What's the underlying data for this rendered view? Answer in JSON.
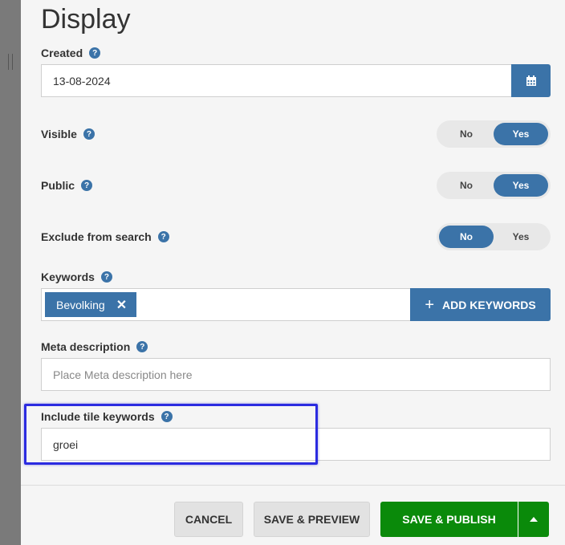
{
  "panel": {
    "title": "Display"
  },
  "created": {
    "label": "Created",
    "help": "?",
    "value": "13-08-2024"
  },
  "visible": {
    "label": "Visible",
    "help": "?",
    "no": "No",
    "yes": "Yes",
    "selected": "Yes"
  },
  "public": {
    "label": "Public",
    "help": "?",
    "no": "No",
    "yes": "Yes",
    "selected": "Yes"
  },
  "exclude_search": {
    "label": "Exclude from search",
    "help": "?",
    "no": "No",
    "yes": "Yes",
    "selected": "No"
  },
  "keywords": {
    "label": "Keywords",
    "help": "?",
    "chips": [
      "Bevolking"
    ],
    "remove_glyph": "✕",
    "add_label": "ADD KEYWORDS"
  },
  "meta_description": {
    "label": "Meta description",
    "help": "?",
    "value": "",
    "placeholder": "Place Meta description here"
  },
  "tile_keywords": {
    "label": "Include tile keywords",
    "help": "?",
    "value": "groei"
  },
  "footer": {
    "cancel_label": "CANCEL",
    "save_preview_label": "SAVE & PREVIEW",
    "save_publish_label": "SAVE & PUBLISH"
  },
  "colors": {
    "accent": "#3b73a8",
    "publish": "#0a8a0a",
    "highlight": "#2b2be0"
  },
  "icons": {
    "calendar": "calendar-icon",
    "help": "question-circle-icon",
    "caret": "caret-up-icon",
    "plus": "plus-icon",
    "remove": "close-icon"
  }
}
